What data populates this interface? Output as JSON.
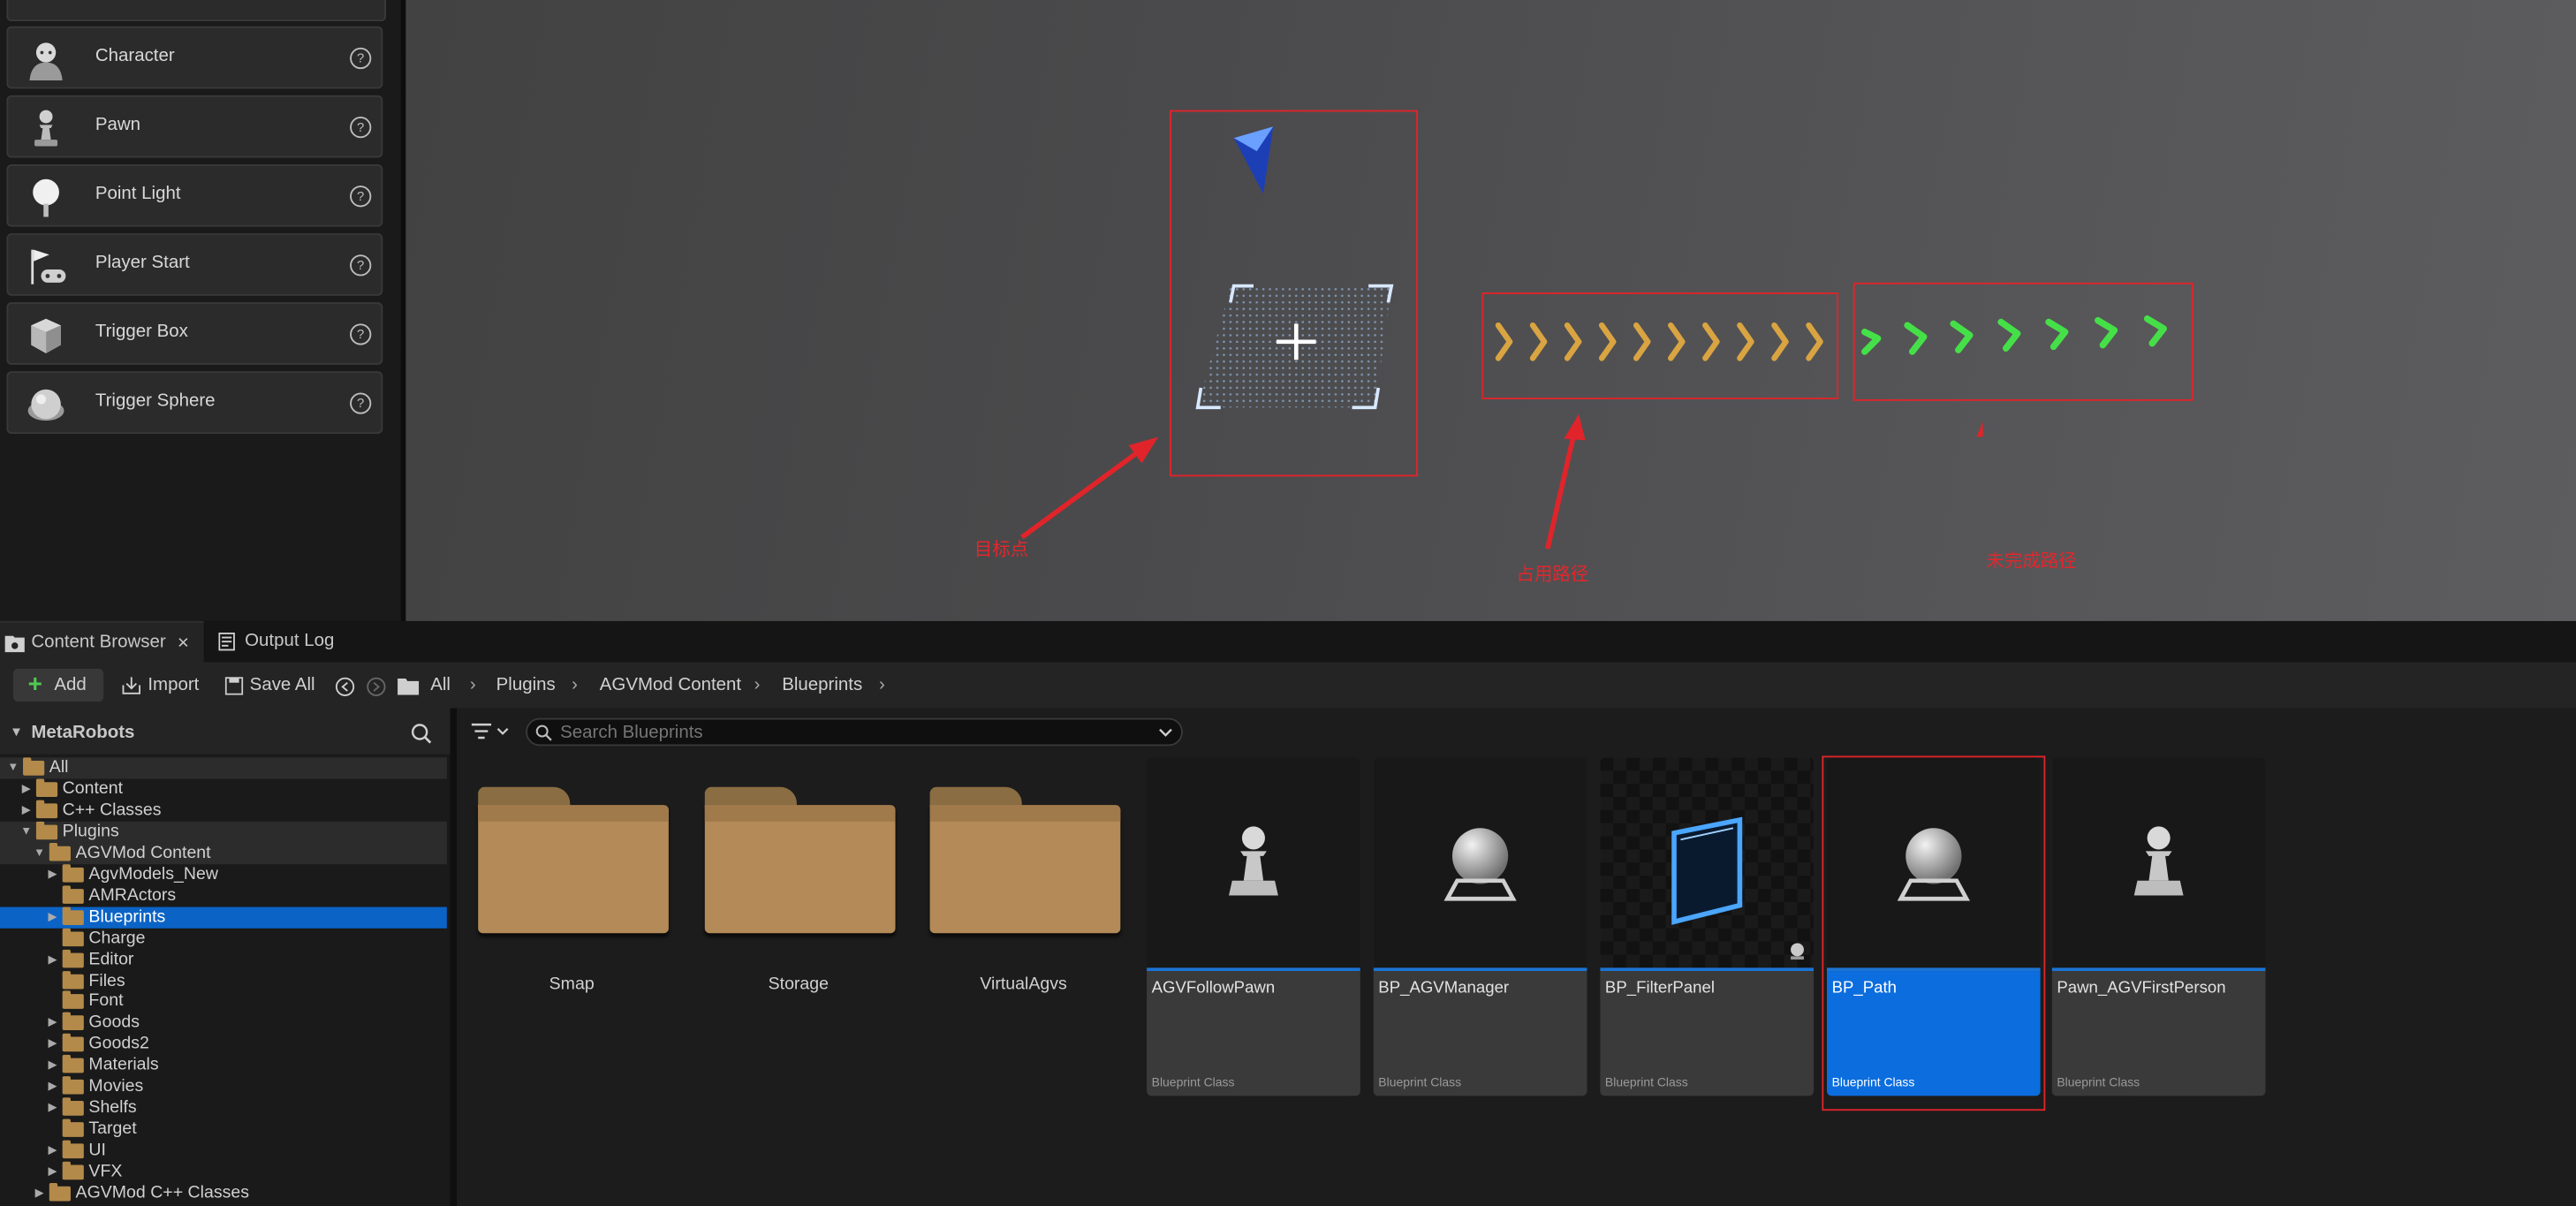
{
  "place_actors": {
    "items": [
      {
        "label": "Character",
        "icon": "character-icon"
      },
      {
        "label": "Pawn",
        "icon": "pawn-icon"
      },
      {
        "label": "Point Light",
        "icon": "point-light-icon"
      },
      {
        "label": "Player Start",
        "icon": "player-start-icon"
      },
      {
        "label": "Trigger Box",
        "icon": "trigger-box-icon"
      },
      {
        "label": "Trigger Sphere",
        "icon": "trigger-sphere-icon"
      }
    ],
    "help_glyph": "?"
  },
  "viewport": {
    "annotations": {
      "target_point": "目标点",
      "occupied_path": "占用路径",
      "unfinished_path": "未完成路径"
    },
    "annotation_color": "#e0242a",
    "occupied_color": "#d9a441",
    "unfinished_color": "#45e048"
  },
  "tabs": {
    "content_browser": "Content Browser",
    "close": "×",
    "output_log": "Output Log"
  },
  "toolbar": {
    "add": "Add",
    "import": "Import",
    "save_all": "Save All",
    "breadcrumb": [
      "All",
      "Plugins",
      "AGVMod Content",
      "Blueprints"
    ]
  },
  "tree": {
    "title": "MetaRobots",
    "rows": [
      {
        "label": "All",
        "expanded": true
      },
      {
        "label": "Content"
      },
      {
        "label": "C++ Classes"
      },
      {
        "label": "Plugins",
        "expanded": true
      },
      {
        "label": "AGVMod Content",
        "expanded": true
      },
      {
        "label": "AgvModels_New"
      },
      {
        "label": "AMRActors"
      },
      {
        "label": "Blueprints",
        "selected": true
      },
      {
        "label": "Charge"
      },
      {
        "label": "Editor"
      },
      {
        "label": "Files"
      },
      {
        "label": "Font"
      },
      {
        "label": "Goods"
      },
      {
        "label": "Goods2"
      },
      {
        "label": "Materials"
      },
      {
        "label": "Movies"
      },
      {
        "label": "Shelfs"
      },
      {
        "label": "Target"
      },
      {
        "label": "UI"
      },
      {
        "label": "VFX"
      },
      {
        "label": "AGVMod C++ Classes"
      }
    ]
  },
  "search": {
    "placeholder": "Search Blueprints"
  },
  "folders": [
    "Smap",
    "Storage",
    "VirtualAgvs"
  ],
  "assets": [
    {
      "name": "AGVFollowPawn",
      "type": "Blueprint Class",
      "thumb": "pawn"
    },
    {
      "name": "BP_AGVManager",
      "type": "Blueprint Class",
      "thumb": "sphere"
    },
    {
      "name": "BP_FilterPanel",
      "type": "Blueprint Class",
      "thumb": "panel"
    },
    {
      "name": "BP_Path",
      "type": "Blueprint Class",
      "thumb": "sphere",
      "selected": true
    },
    {
      "name": "Pawn_AGVFirstPerson",
      "type": "Blueprint Class",
      "thumb": "pawn"
    }
  ],
  "colors": {
    "selection_blue": "#0b6dde",
    "folder": "#b38a58"
  }
}
